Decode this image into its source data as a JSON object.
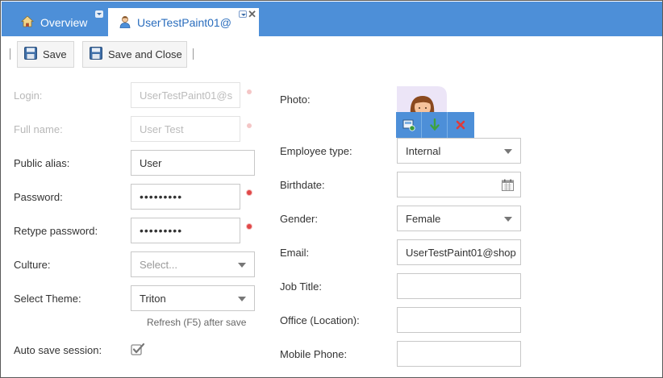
{
  "tabs": [
    {
      "label": "Overview",
      "icon": "home-icon"
    },
    {
      "label": "UserTestPaint01@",
      "icon": "user-icon"
    }
  ],
  "toolbar": {
    "save_label": "Save",
    "save_close_label": "Save and Close"
  },
  "form": {
    "login": {
      "label": "Login:",
      "value": "UserTestPaint01@s"
    },
    "full_name": {
      "label": "Full name:",
      "value": "User Test"
    },
    "public_alias": {
      "label": "Public alias:",
      "value": "User"
    },
    "password": {
      "label": "Password:",
      "value": "•••••••••"
    },
    "retype_password": {
      "label": "Retype password:",
      "value": "•••••••••"
    },
    "culture": {
      "label": "Culture:",
      "placeholder": "Select..."
    },
    "theme": {
      "label": "Select Theme:",
      "value": "Triton",
      "hint": "Refresh (F5) after save"
    },
    "auto_save": {
      "label": "Auto save session:",
      "checked": true
    },
    "photo": {
      "label": "Photo:"
    },
    "employee_type": {
      "label": "Employee type:",
      "value": "Internal"
    },
    "birthdate": {
      "label": "Birthdate:",
      "value": ""
    },
    "gender": {
      "label": "Gender:",
      "value": "Female"
    },
    "email": {
      "label": "Email:",
      "value": "UserTestPaint01@shop"
    },
    "job_title": {
      "label": "Job Title:",
      "value": ""
    },
    "office": {
      "label": "Office (Location):",
      "value": ""
    },
    "mobile_phone": {
      "label": "Mobile Phone:",
      "value": ""
    }
  },
  "colors": {
    "accent": "#4d8fd8",
    "required": "#e04848"
  }
}
